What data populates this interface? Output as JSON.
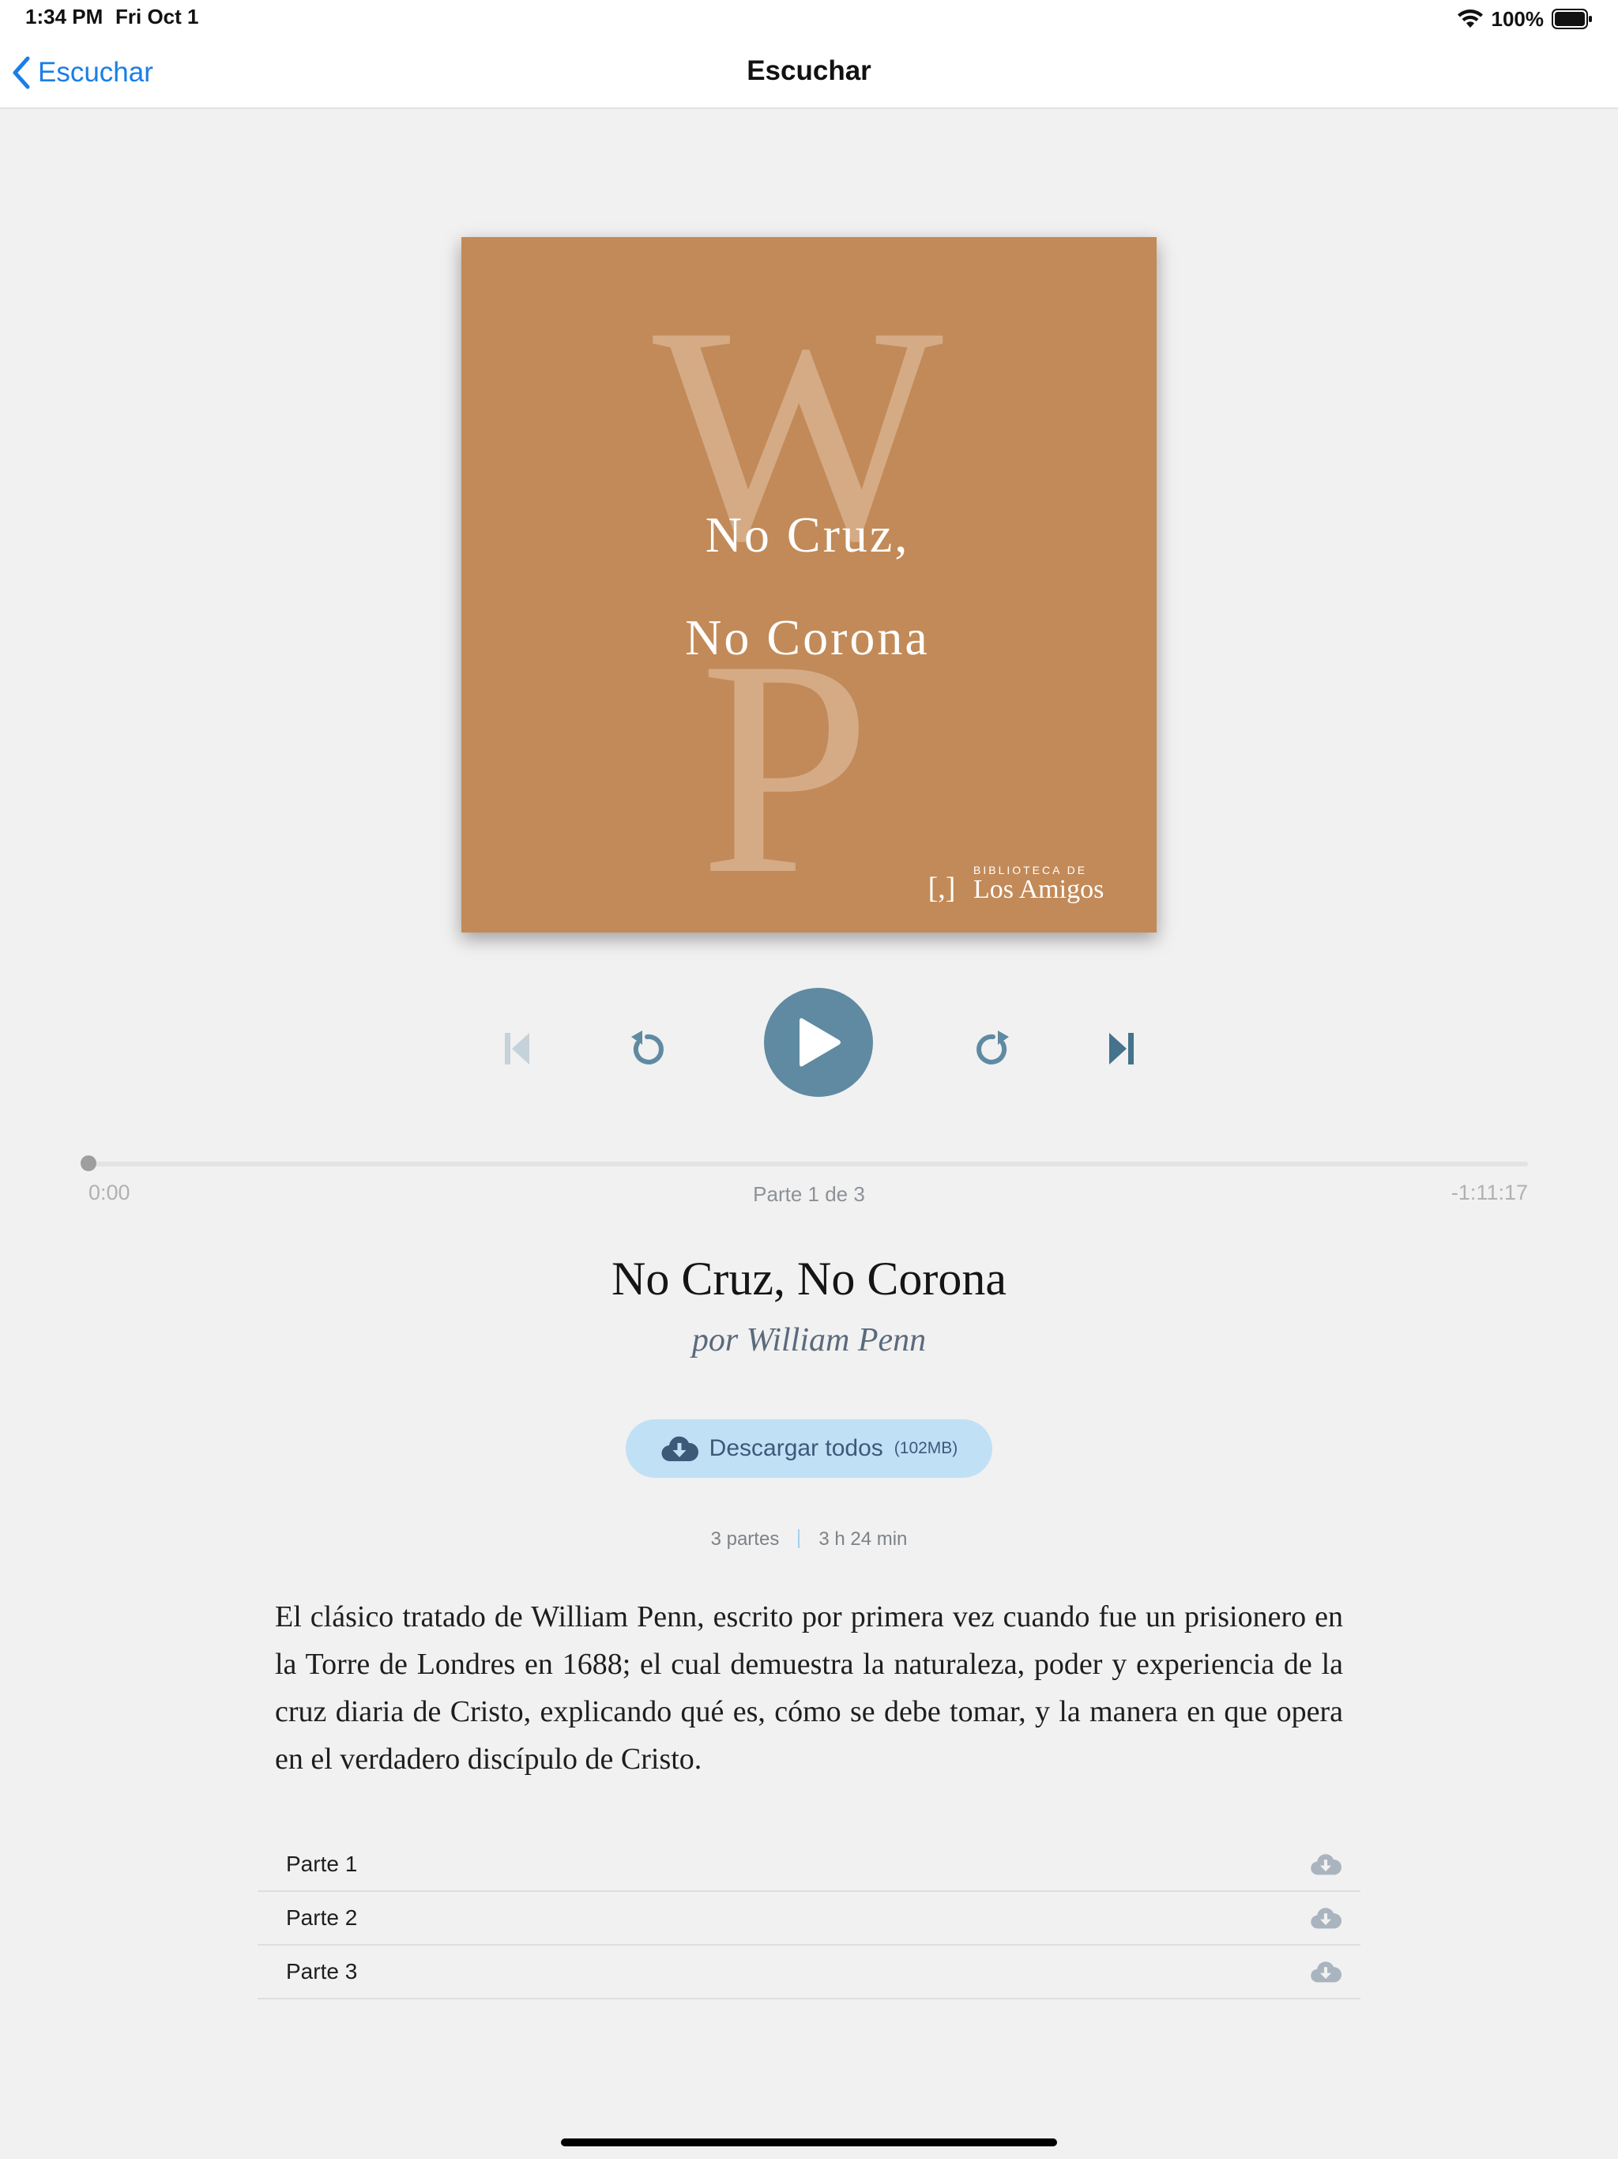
{
  "status_bar": {
    "time": "1:34 PM",
    "date": "Fri Oct 1",
    "battery": "100%"
  },
  "nav": {
    "back_label": "Escuchar",
    "title": "Escuchar"
  },
  "cover": {
    "monogram_top": "W",
    "monogram_bottom": "P",
    "title_line1": "No Cruz,",
    "title_line2": "No Corona",
    "publisher_small": "BIBLIOTECA DE",
    "publisher_large": "Los Amigos",
    "publisher_mark": "[,]",
    "background_color": "#c28a58"
  },
  "player": {
    "elapsed": "0:00",
    "remaining": "-1:11:17",
    "part_indicator": "Parte 1 de 3",
    "progress_fraction": 0,
    "accent_color": "#5f8aa2"
  },
  "book": {
    "title": "No Cruz, No Corona",
    "author": "por William Penn",
    "download_all_label": "Descargar todos",
    "download_all_size": "(102MB)",
    "parts_count": "3 partes",
    "duration": "3 h 24 min",
    "description": "El clásico tratado de William Penn, escrito por primera vez cuando fue un prisionero en la Torre de Londres en 1688; el cual demuestra la naturaleza, poder y experiencia de la cruz diaria de Cristo, explicando qué es, cómo se debe tomar, y la manera en que opera en el verdadero discípulo de Cristo."
  },
  "parts": [
    {
      "label": "Parte 1"
    },
    {
      "label": "Parte 2"
    },
    {
      "label": "Parte 3"
    }
  ]
}
